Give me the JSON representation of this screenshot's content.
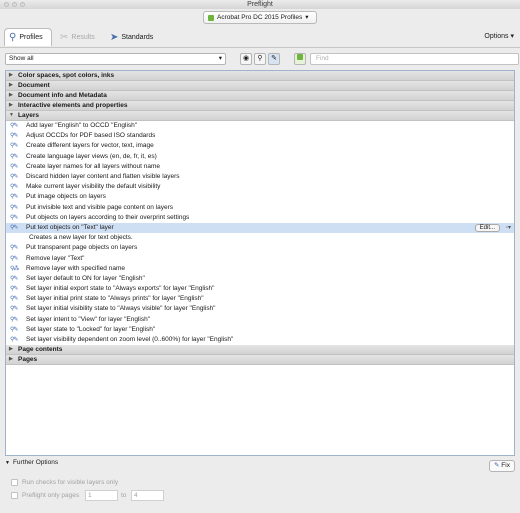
{
  "window": {
    "title": "Preflight"
  },
  "profile": {
    "selected": "Acrobat Pro DC 2015 Profiles",
    "arrow": "▾"
  },
  "tabs": [
    {
      "label": "Profiles"
    },
    {
      "label": "Results"
    },
    {
      "label": "Standards"
    }
  ],
  "toolbar": {
    "options": "Options",
    "options_arrow": "▾"
  },
  "filter": {
    "show_value": "Show all",
    "arrow": "▾",
    "find_placeholder": "Find"
  },
  "categories_top": [
    "Color spaces, spot colors, inks",
    "Document",
    "Document info and Metadata",
    "Interactive elements and properties",
    "Layers"
  ],
  "layer_items": [
    "Add layer \"English\" to OCCD \"English\"",
    "Adjust OCCDs for PDF based ISO standards",
    "Create different layers for vector, text, image",
    "Create language layer views (en, de, fr, it, es)",
    "Create layer names for all layers without name",
    "Discard hidden layer content and flatten visible layers",
    "Make current layer visibility the default visibility",
    "Put image objects on layers",
    "Put invisible text and visible page content on layers",
    "Put objects on layers according to their overprint settings",
    "Put text objects on \"Text\" layer"
  ],
  "selected_description": "Creates a new layer for text objects.",
  "edit_label": "Edit...",
  "layer_items_after": [
    "Put transparent page objects on layers",
    "Remove layer \"Text\"",
    "Remove layer with specified name",
    "Set layer default to ON for layer \"English\"",
    "Set layer initial export state to \"Always exports\" for layer \"English\"",
    "Set layer initial print state to \"Always prints\" for layer \"English\"",
    "Set layer initial visibility state to \"Always visible\" for layer \"English\"",
    "Set layer intent to \"View\" for layer \"English\"",
    "Set layer state to \"Locked\" for layer \"English\"",
    "Set layer visibility dependent on zoom level (0..600%) for layer \"English\""
  ],
  "categories_bottom": [
    "Page contents",
    "Pages"
  ],
  "further": {
    "label": "Further Options",
    "fix": "Fix",
    "run_checks": "Run checks for visible layers only",
    "only_pages": "Preflight only pages",
    "from": "1",
    "to_label": "to",
    "to": "4"
  }
}
